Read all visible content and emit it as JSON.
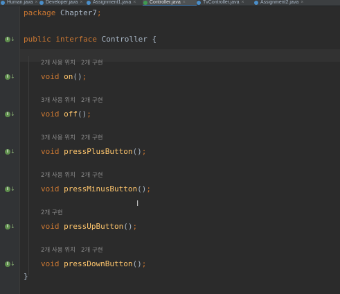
{
  "tabs": [
    {
      "label": "Human.java",
      "kind": "class"
    },
    {
      "label": "Developer.java",
      "kind": "class"
    },
    {
      "label": "Assignment1.java",
      "kind": "class"
    },
    {
      "label": "Controller.java",
      "kind": "interface",
      "active": true
    },
    {
      "label": "TvController.java",
      "kind": "class"
    },
    {
      "label": "Assignment2.java",
      "kind": "class"
    }
  ],
  "code": {
    "package_kw": "package",
    "package_name": "Chapter7",
    "semicolon": ";",
    "public_kw": "public",
    "interface_kw": "interface",
    "iface_name": "Controller",
    "open_brace": "{",
    "close_brace": "}",
    "void_kw": "void",
    "methods": [
      {
        "hint": "2개 사용 위치   2개 구현",
        "name": "on",
        "sig": "()",
        "end": ";"
      },
      {
        "hint": "3개 사용 위치   2개 구현",
        "name": "off",
        "sig": "()",
        "end": ";"
      },
      {
        "hint": "3개 사용 위치   2개 구현",
        "name": "pressPlusButton",
        "sig": "()",
        "end": ";"
      },
      {
        "hint": "2개 사용 위치   2개 구현",
        "name": "pressMinusButton",
        "sig": "()",
        "end": ";"
      },
      {
        "hint": "2개 구현",
        "name": "pressUpButton",
        "sig": "()",
        "end": ";"
      },
      {
        "hint": "2개 사용 위치   2개 구현",
        "name": "pressDownButton",
        "sig": "()",
        "end": ";"
      }
    ]
  },
  "gutter_icon": "implemented-down-arrow-icon",
  "colors": {
    "background": "#2b2b2b",
    "keyword": "#cc7832",
    "method": "#ffc66d",
    "text": "#a9b7c6",
    "hint": "#8c8c8c"
  }
}
